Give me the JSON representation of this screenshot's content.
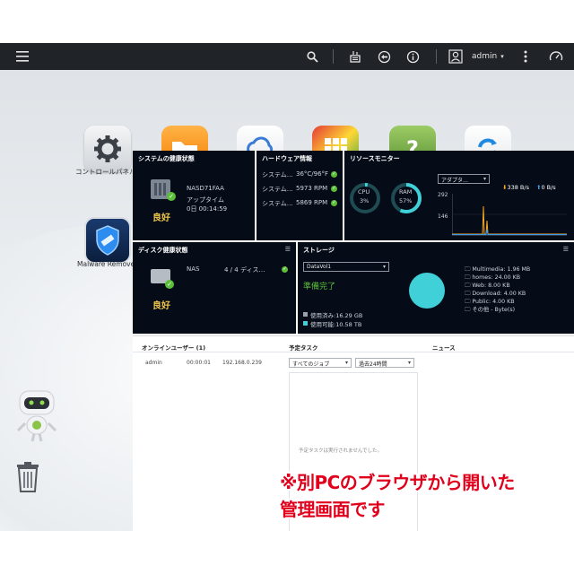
{
  "topbar": {
    "menu_icon": "hamburger-icon",
    "search_icon": "search-icon",
    "user": "admin",
    "colors": {
      "bar": "#202327"
    }
  },
  "desktop": {
    "apps": [
      {
        "label": "コントロールパネル",
        "icon": "gear-icon"
      },
      {
        "label": "",
        "icon": "folder-icon"
      },
      {
        "label": "",
        "icon": "cloud-icon"
      },
      {
        "label": "",
        "icon": "app-center-icon"
      },
      {
        "label": "",
        "icon": "help-icon"
      },
      {
        "label": "",
        "icon": "sync-icon"
      },
      {
        "label": "Malware Remover",
        "icon": "shield-icon"
      }
    ]
  },
  "system_health": {
    "title": "システムの健康状態",
    "device": "NASD71FAA",
    "uptime_label": "アップタイム",
    "uptime": "0日 00:14:59",
    "status": "良好"
  },
  "hardware": {
    "title": "ハードウェア情報",
    "rows": [
      {
        "label": "システム…",
        "value": "36°C/96°F"
      },
      {
        "label": "システム…",
        "value": "5973 RPM"
      },
      {
        "label": "システム…",
        "value": "5869 RPM"
      }
    ]
  },
  "resource": {
    "title": "リソースモニター",
    "cpu_label": "CPU",
    "cpu_value": "3%",
    "cpu_fraction": 0.03,
    "ram_label": "RAM",
    "ram_value": "57%",
    "ram_fraction": 0.57,
    "adapter": "アダプタ…",
    "down_rate": "338 B/s",
    "up_rate": "0 B/s",
    "y_max": "292",
    "y_mid": "146"
  },
  "disk_health": {
    "title": "ディスク健康状態",
    "device": "NAS",
    "disks": "4 / 4 ディス…",
    "status": "良好"
  },
  "storage": {
    "title": "ストレージ",
    "volume": "DataVol1",
    "status": "準備完了",
    "used": "使用済み:16.29 GB",
    "free": "使用可能:10.58 TB",
    "folders": [
      "Multimedia: 1.96 MB",
      "homes: 24.00 KB",
      "Web: 8.00 KB",
      "Download: 4.00 KB",
      "Public: 4.00 KB",
      "その他 - Byte(s)"
    ],
    "colors": {
      "free": "#3fd0d8",
      "used": "#9aa1ab"
    }
  },
  "online_users": {
    "title": "オンラインユーザー (1)",
    "rows": [
      {
        "user": "admin",
        "time": "00:00:01",
        "ip": "192.168.0.239"
      }
    ]
  },
  "scheduled": {
    "title": "予定タスク",
    "filter1": "すべてのジョブ",
    "filter2": "過去24時間",
    "empty": "予定タスクは実行されませんでした。"
  },
  "news": {
    "title": "ニュース"
  },
  "overlay": {
    "line1": "※別PCのブラウザから開いた",
    "line2": "管理画面です"
  }
}
